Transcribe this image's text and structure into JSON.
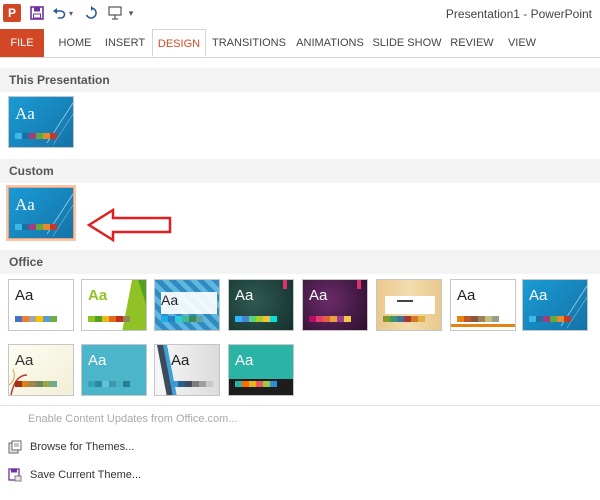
{
  "window": {
    "title": "Presentation1 - PowerPoint"
  },
  "qat": {
    "app_icon": "powerpoint-icon",
    "app_letter": "P",
    "save_icon": "save-icon",
    "undo_icon": "undo-icon",
    "redo_icon": "redo-icon",
    "start_icon": "start-from-beginning-icon"
  },
  "ribbon": {
    "tabs": [
      {
        "label": "FILE"
      },
      {
        "label": "HOME"
      },
      {
        "label": "INSERT"
      },
      {
        "label": "DESIGN"
      },
      {
        "label": "TRANSITIONS"
      },
      {
        "label": "ANIMATIONS"
      },
      {
        "label": "SLIDE SHOW"
      },
      {
        "label": "REVIEW"
      },
      {
        "label": "VIEW"
      }
    ],
    "active_tab": "DESIGN"
  },
  "sections": {
    "this_presentation": "This Presentation",
    "custom": "Custom",
    "office": "Office"
  },
  "thumb_text": "Aa",
  "menu": {
    "enable_updates": "Enable Content Updates from Office.com...",
    "browse": "Browse for Themes...",
    "save_current": "Save Current Theme..."
  },
  "colors": {
    "accent": "#d24726",
    "annotation_arrow": "#e02020"
  }
}
